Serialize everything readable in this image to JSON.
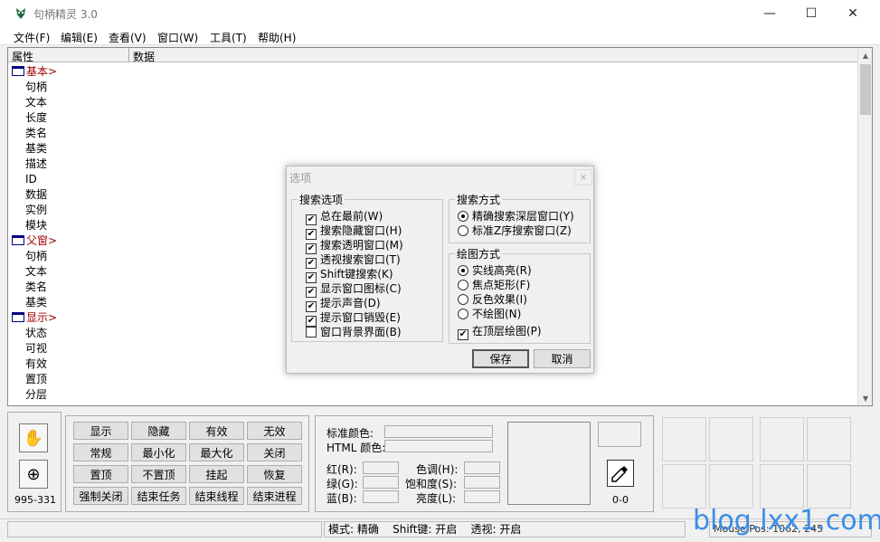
{
  "window": {
    "title": "句柄精灵 3.0",
    "controls": [
      "—",
      "☐",
      "✕"
    ]
  },
  "menu": [
    "文件(F)",
    "编辑(E)",
    "查看(V)",
    "窗口(W)",
    "工具(T)",
    "帮助(H)"
  ],
  "prop_list": {
    "columns": [
      "属性",
      "数据"
    ],
    "groups": [
      {
        "label": "基本>",
        "items": [
          "句柄",
          "文本",
          "长度",
          "类名",
          "基类",
          "描述",
          "ID",
          "数据",
          "实例",
          "模块"
        ]
      },
      {
        "label": "父窗>",
        "items": [
          "句柄",
          "文本",
          "类名",
          "基类"
        ]
      },
      {
        "label": "显示>",
        "items": [
          "状态",
          "可视",
          "有效",
          "置顶",
          "分层"
        ]
      }
    ]
  },
  "dialog": {
    "title": "选项",
    "close": "×",
    "search_options": {
      "label": "搜索选项",
      "items": [
        {
          "label": "总在最前(W)",
          "checked": true
        },
        {
          "label": "搜索隐藏窗口(H)",
          "checked": true
        },
        {
          "label": "搜索透明窗口(M)",
          "checked": true
        },
        {
          "label": "透视搜索窗口(T)",
          "checked": true
        },
        {
          "label": "Shift键搜索(K)",
          "checked": true
        },
        {
          "label": "显示窗口图标(C)",
          "checked": true
        },
        {
          "label": "提示声音(D)",
          "checked": true
        },
        {
          "label": "提示窗口销毁(E)",
          "checked": true
        },
        {
          "label": "窗口背景界面(B)",
          "checked": false
        }
      ]
    },
    "search_method": {
      "label": "搜索方式",
      "items": [
        {
          "label": "精确搜索深层窗口(Y)",
          "selected": true
        },
        {
          "label": "标准Z序搜索窗口(Z)",
          "selected": false
        }
      ]
    },
    "draw_method": {
      "label": "绘图方式",
      "items": [
        {
          "label": "实线高亮(R)",
          "selected": true
        },
        {
          "label": "焦点矩形(F)",
          "selected": false
        },
        {
          "label": "反色效果(I)",
          "selected": false
        },
        {
          "label": "不绘图(N)",
          "selected": false
        }
      ],
      "top_layer": {
        "label": "在顶层绘图(P)",
        "checked": true
      }
    },
    "save": "保存",
    "cancel": "取消"
  },
  "tools": {
    "coord": "995-331"
  },
  "action_buttons": [
    [
      "显示",
      "隐藏",
      "有效",
      "无效"
    ],
    [
      "常规",
      "最小化",
      "最大化",
      "关闭"
    ],
    [
      "置顶",
      "不置顶",
      "挂起",
      "恢复"
    ],
    [
      "强制关闭",
      "结束任务",
      "结束线程",
      "结束进程"
    ]
  ],
  "color": {
    "std_color": "标准颜色:",
    "html_color": "HTML 颜色:",
    "red": "红(R):",
    "green": "绿(G):",
    "blue": "蓝(B):",
    "hue": "色调(H):",
    "saturation": "饱和度(S):",
    "brightness": "亮度(L):",
    "picker_value": "0-0"
  },
  "status": {
    "mode": "模式: 精确",
    "shift": "Shift键: 开启",
    "perspective": "透视: 开启",
    "mouse_pos": "Mouse Pos: 1062, 245"
  },
  "watermark": "blog.lxx1.com",
  "colors": {
    "group_text": "#a00000",
    "watermark": "#3a8ee6"
  }
}
